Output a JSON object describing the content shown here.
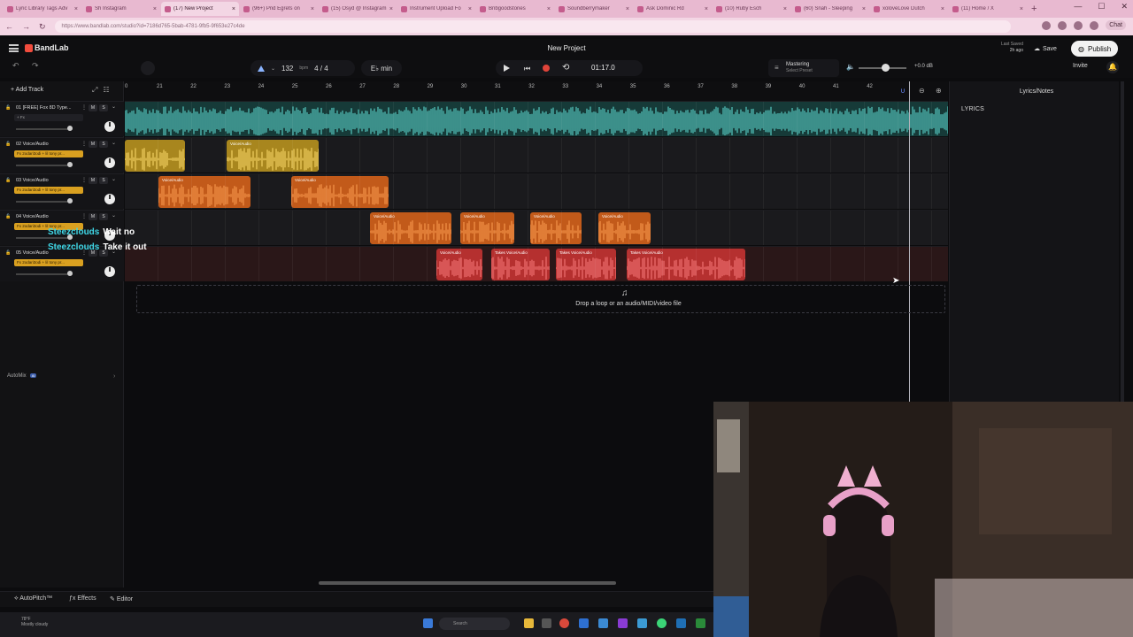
{
  "browser": {
    "tabs": [
      {
        "label": "Lyric Library Tags Adv"
      },
      {
        "label": "Sh Instagram"
      },
      {
        "label": "(17) New Project"
      },
      {
        "label": "(96+) Pnd Egrets on"
      },
      {
        "label": "(15) Osyd @ Instagram"
      },
      {
        "label": "Instrument Upload Fo"
      },
      {
        "label": "Bnbgoodstones"
      },
      {
        "label": "Soundberrymaker"
      },
      {
        "label": "Ask Dominic Rd"
      },
      {
        "label": "(10) Ruby Esch"
      },
      {
        "label": "(60) Snah - Sleeping"
      },
      {
        "label": "xoloveLove Dutch"
      },
      {
        "label": "(11) Home / X"
      }
    ],
    "url": "https://www.bandlab.com/studio?id=7186d765-5bab-4781-9fb5-9f653e27c4de",
    "chat_label": "Chat"
  },
  "app": {
    "brand": "BandLab",
    "project_name": "New Project",
    "last_saved_label": "Last Saved",
    "last_saved_time": "2h ago",
    "save": "Save",
    "publish": "Publish",
    "invite": "Invite"
  },
  "transport": {
    "tempo": "132",
    "tempo_unit": "bpm",
    "time_signature": "4 / 4",
    "key": "E♭ min",
    "time": "01:17.0",
    "mastering_label": "Mastering",
    "mastering_preset": "Select Preset",
    "volume_db": "+0.0 dB"
  },
  "tracks_panel": {
    "add_track": "Add Track",
    "automix": "AutoMix",
    "automix_badge": "AI",
    "tracks": [
      {
        "num": "01",
        "name": "01  [FREE] Fox 8D Type...",
        "fx": "+ Fx",
        "m": "M",
        "s": "S",
        "color": "#2f8f88"
      },
      {
        "num": "02",
        "name": "02  Voice/Audio",
        "fx": "Fx 2odari3odi + lil tony pr...",
        "m": "M",
        "s": "S",
        "color": "#c9a227"
      },
      {
        "num": "03",
        "name": "03  Voice/Audio",
        "fx": "Fx 2odari3odi + lil tony pr...",
        "m": "M",
        "s": "S",
        "color": "#d96a1f"
      },
      {
        "num": "04",
        "name": "04  Voice/Audio",
        "fx": "Fx 2odari3odi + lil tony pr...",
        "m": "M",
        "s": "S",
        "color": "#d96a1f"
      },
      {
        "num": "05",
        "name": "05  Voice/Audio",
        "fx": "Fx 2odari3odi + lil tony pr...",
        "m": "M",
        "s": "S",
        "color": "#c93a3a"
      }
    ]
  },
  "ruler": {
    "labels": [
      "0",
      "21",
      "22",
      "23",
      "24",
      "25",
      "26",
      "27",
      "28",
      "29",
      "30",
      "31",
      "32",
      "33",
      "34",
      "35",
      "36",
      "37",
      "38",
      "39",
      "40",
      "41",
      "42"
    ]
  },
  "clips": {
    "voice_audio": "Voice/Audio",
    "takes": "Takes"
  },
  "dropzone": {
    "text": "Drop a loop or an audio/MIDI/video file"
  },
  "right_panel": {
    "title": "Lyrics/Notes",
    "lyrics_label": "LYRICS"
  },
  "bottom_toolbar": {
    "autopitch": "AutoPitch™",
    "effects": "Effects",
    "editor": "Editor"
  },
  "taskbar": {
    "weather_temp": "78°F",
    "weather_desc": "Mostly cloudy",
    "search_placeholder": "Search"
  },
  "chat_overlay": [
    {
      "user": "Steezclouds",
      "message": "Wait no"
    },
    {
      "user": "Steezclouds",
      "message": "Take it out"
    }
  ],
  "colors": {
    "teal_clip": "#2f8f88",
    "yellow_clip": "#a8861e",
    "orange_clip": "#c25a1a",
    "red_clip": "#b5302f",
    "record": "#e0443a",
    "chat_user": "#3fd8e8"
  }
}
